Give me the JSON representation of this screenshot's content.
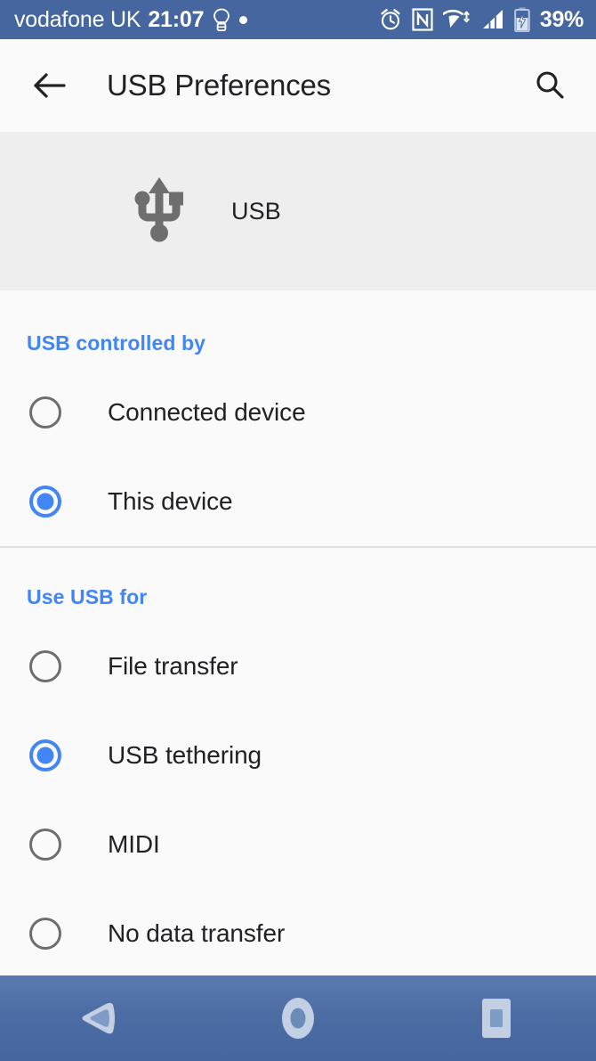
{
  "status_bar": {
    "carrier": "vodafone UK",
    "time": "21:07",
    "battery_percent": "39%",
    "icons_left": [
      "lightbulb-icon",
      "dot-icon"
    ],
    "icons_right": [
      "alarm-icon",
      "nfc-icon",
      "wifi-icon",
      "signal-icon",
      "battery-charging-icon"
    ],
    "background_color": "#45669e"
  },
  "app_bar": {
    "title": "USB Preferences",
    "back_icon": "back-arrow-icon",
    "search_icon": "search-icon"
  },
  "usb_card": {
    "icon": "usb-icon",
    "label": "USB",
    "background_color": "#eeeeee"
  },
  "sections": [
    {
      "header": "USB controlled by",
      "accent_color": "#4285f4",
      "options": [
        {
          "label": "Connected device",
          "selected": false
        },
        {
          "label": "This device",
          "selected": true
        }
      ]
    },
    {
      "header": "Use USB for",
      "accent_color": "#4285f4",
      "options": [
        {
          "label": "File transfer",
          "selected": false
        },
        {
          "label": "USB tethering",
          "selected": true
        },
        {
          "label": "MIDI",
          "selected": false
        },
        {
          "label": "No data transfer",
          "selected": false
        }
      ]
    }
  ],
  "nav_bar": {
    "buttons": [
      {
        "name": "back-nav-icon"
      },
      {
        "name": "home-nav-icon"
      },
      {
        "name": "recents-nav-icon"
      }
    ],
    "background_color": "#45669e"
  }
}
